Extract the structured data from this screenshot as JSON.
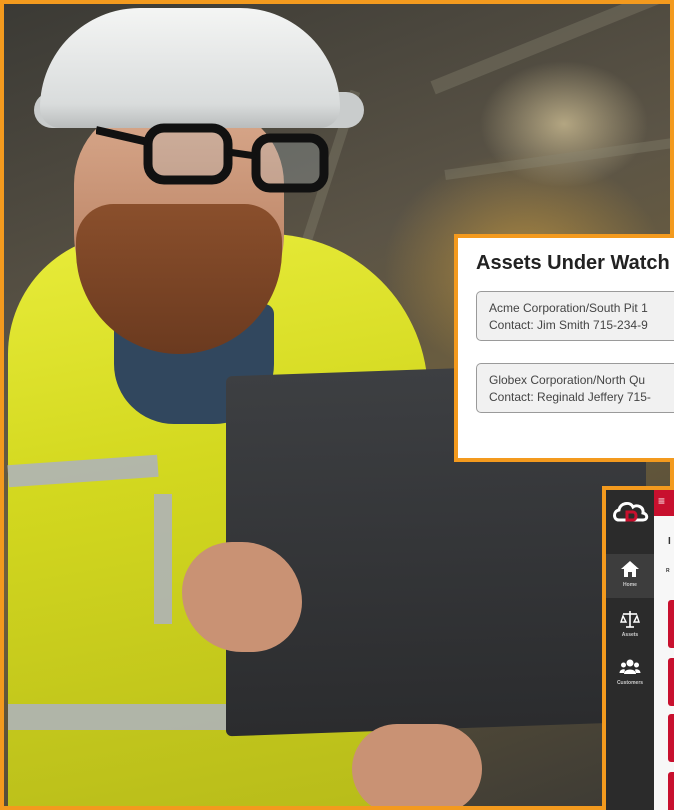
{
  "watch_card": {
    "title": "Assets Under Watch",
    "items": [
      {
        "line1": "Acme Corporation/South Pit 1",
        "line2": "Contact: Jim Smith 715-234-9"
      },
      {
        "line1": "Globex Corporation/North Qu",
        "line2": "Contact: Reginald Jeffery 715-"
      }
    ]
  },
  "app": {
    "menu_glyph": "≡",
    "nav": [
      {
        "label": "Home",
        "icon": "home-icon",
        "active": true
      },
      {
        "label": "Assets",
        "icon": "scale-icon",
        "active": false
      },
      {
        "label": "Customers",
        "icon": "users-icon",
        "active": false
      }
    ],
    "content_title": "I",
    "content_sub": "R"
  },
  "colors": {
    "frame": "#f39a1e",
    "brand_red": "#c8102e",
    "sidebar": "#2b2b2b"
  }
}
